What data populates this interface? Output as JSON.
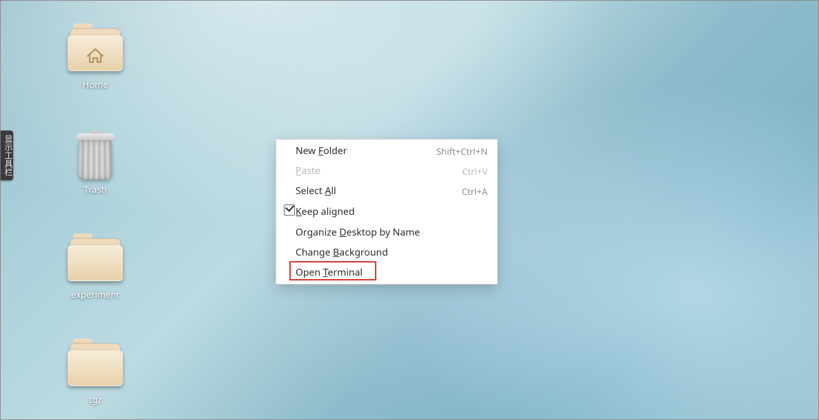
{
  "toolbar_tab": "显示工具栏",
  "desktop_icons": [
    {
      "name": "home",
      "label": "Home"
    },
    {
      "name": "trash",
      "label": "Trash"
    },
    {
      "name": "experiment",
      "label": "experiment"
    },
    {
      "name": "tgz",
      "label": "tgz"
    }
  ],
  "context_menu": {
    "items": [
      {
        "label_pre": "New ",
        "mnemonic": "F",
        "label_post": "older",
        "accel": "Shift+Ctrl+N",
        "enabled": true,
        "checked": false
      },
      {
        "label_pre": "",
        "mnemonic": "P",
        "label_post": "aste",
        "accel": "Ctrl+V",
        "enabled": false,
        "checked": false
      },
      {
        "label_pre": "Select ",
        "mnemonic": "A",
        "label_post": "ll",
        "accel": "Ctrl+A",
        "enabled": true,
        "checked": false
      },
      {
        "label_pre": "",
        "mnemonic": "K",
        "label_post": "eep aligned",
        "accel": "",
        "enabled": true,
        "checked": true
      },
      {
        "label_pre": "Organize ",
        "mnemonic": "D",
        "label_post": "esktop by Name",
        "accel": "",
        "enabled": true,
        "checked": false
      },
      {
        "label_pre": "Change ",
        "mnemonic": "B",
        "label_post": "ackground",
        "accel": "",
        "enabled": true,
        "checked": false
      },
      {
        "label_pre": "Open ",
        "mnemonic": "T",
        "label_post": "erminal",
        "accel": "",
        "enabled": true,
        "checked": false
      }
    ]
  }
}
